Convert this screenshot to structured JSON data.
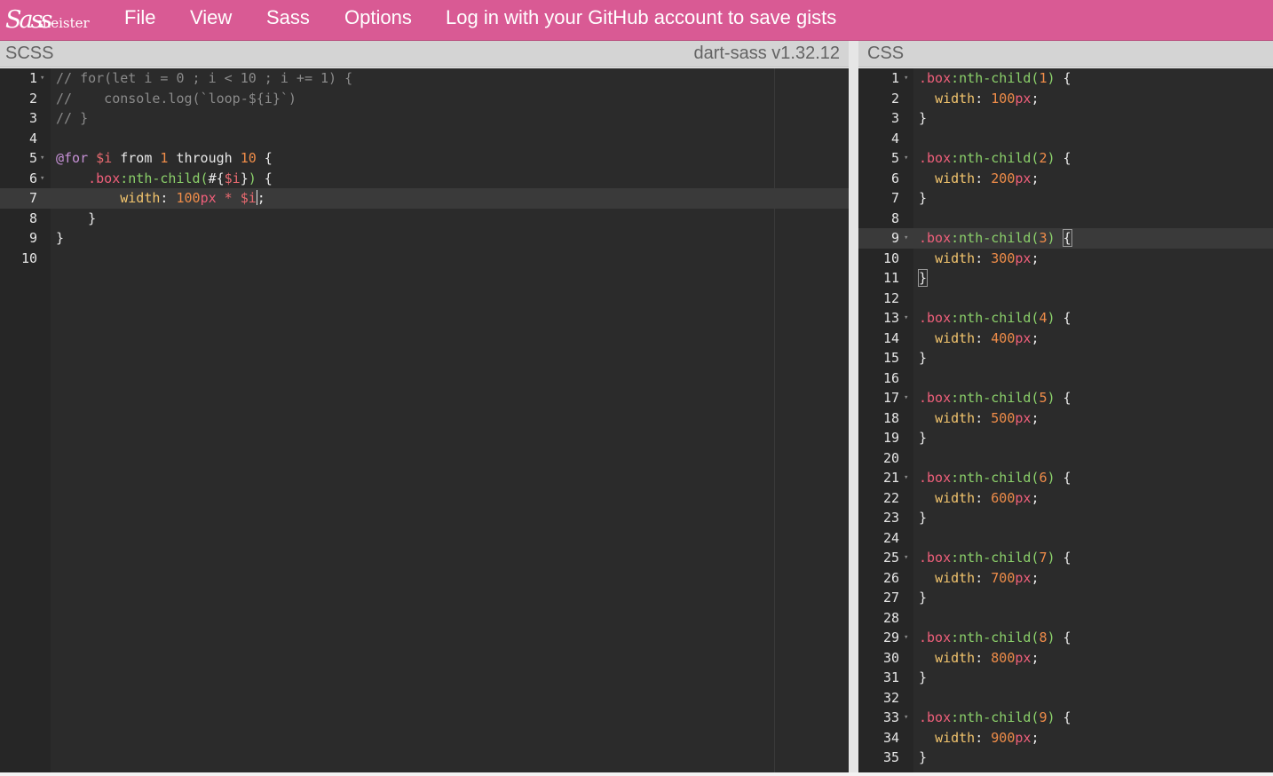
{
  "brand": {
    "logo_script": "Sass",
    "logo_text": "meister"
  },
  "nav": {
    "file": "File",
    "view": "View",
    "sass": "Sass",
    "options": "Options",
    "login": "Log in with your GitHub account to save gists"
  },
  "scss_panel": {
    "title": "SCSS",
    "compiler": "dart-sass v1.32.12"
  },
  "css_panel": {
    "title": "CSS"
  },
  "colors": {
    "topbar": "#d95a94",
    "editor_bg": "#2b2b2b",
    "comment": "#8a8a8a",
    "keyword": "#c691d6",
    "number": "#f08d49",
    "selector": "#ef5f7a",
    "pseudo": "#8bd06a",
    "property": "#f2c46d"
  },
  "scss_lines": [
    {
      "n": "1",
      "fold": true,
      "tokens": [
        [
          "c",
          "// for(let i = 0 ; i < 10 ; i += 1) {"
        ]
      ]
    },
    {
      "n": "2",
      "tokens": [
        [
          "c",
          "//    console.log(`loop-${i}`)"
        ]
      ]
    },
    {
      "n": "3",
      "tokens": [
        [
          "c",
          "// }"
        ]
      ]
    },
    {
      "n": "4",
      "tokens": []
    },
    {
      "n": "5",
      "fold": true,
      "tokens": [
        [
          "k",
          "@for"
        ],
        [
          "p",
          " "
        ],
        [
          "v",
          "$i"
        ],
        [
          "p",
          " from "
        ],
        [
          "n",
          "1"
        ],
        [
          "p",
          " through "
        ],
        [
          "n",
          "10"
        ],
        [
          "p",
          " {"
        ]
      ]
    },
    {
      "n": "6",
      "fold": true,
      "tokens": [
        [
          "p",
          "    "
        ],
        [
          "s",
          ".box"
        ],
        [
          "ps",
          ":nth-child("
        ],
        [
          "p",
          "#{"
        ],
        [
          "v",
          "$i"
        ],
        [
          "p",
          "}"
        ],
        [
          "ps",
          ")"
        ],
        [
          "p",
          " {"
        ]
      ]
    },
    {
      "n": "7",
      "active": true,
      "tokens": [
        [
          "p",
          "        "
        ],
        [
          "pr",
          "width"
        ],
        [
          "p",
          ": "
        ],
        [
          "n",
          "100"
        ],
        [
          "u",
          "px"
        ],
        [
          "p",
          " "
        ],
        [
          "o",
          "*"
        ],
        [
          "p",
          " "
        ],
        [
          "v",
          "$i"
        ],
        [
          "p",
          ";"
        ]
      ]
    },
    {
      "n": "8",
      "tokens": [
        [
          "p",
          "    }"
        ]
      ]
    },
    {
      "n": "9",
      "tokens": [
        [
          "p",
          "}"
        ]
      ]
    },
    {
      "n": "10",
      "tokens": []
    }
  ],
  "css_lines": [
    {
      "n": "1",
      "fold": true,
      "tokens": [
        [
          "s",
          ".box"
        ],
        [
          "ps",
          ":nth-child("
        ],
        [
          "n",
          "1"
        ],
        [
          "ps",
          ")"
        ],
        [
          "p",
          " {"
        ]
      ]
    },
    {
      "n": "2",
      "tokens": [
        [
          "p",
          "  "
        ],
        [
          "pr",
          "width"
        ],
        [
          "p",
          ": "
        ],
        [
          "n",
          "100"
        ],
        [
          "u",
          "px"
        ],
        [
          "p",
          ";"
        ]
      ]
    },
    {
      "n": "3",
      "tokens": [
        [
          "p",
          "}"
        ]
      ]
    },
    {
      "n": "4",
      "tokens": []
    },
    {
      "n": "5",
      "fold": true,
      "tokens": [
        [
          "s",
          ".box"
        ],
        [
          "ps",
          ":nth-child("
        ],
        [
          "n",
          "2"
        ],
        [
          "ps",
          ")"
        ],
        [
          "p",
          " {"
        ]
      ]
    },
    {
      "n": "6",
      "tokens": [
        [
          "p",
          "  "
        ],
        [
          "pr",
          "width"
        ],
        [
          "p",
          ": "
        ],
        [
          "n",
          "200"
        ],
        [
          "u",
          "px"
        ],
        [
          "p",
          ";"
        ]
      ]
    },
    {
      "n": "7",
      "tokens": [
        [
          "p",
          "}"
        ]
      ]
    },
    {
      "n": "8",
      "tokens": []
    },
    {
      "n": "9",
      "fold": true,
      "active": true,
      "tokens": [
        [
          "s",
          ".box"
        ],
        [
          "ps",
          ":nth-child("
        ],
        [
          "n",
          "3"
        ],
        [
          "ps",
          ")"
        ],
        [
          "p",
          " "
        ],
        [
          "bh",
          "{"
        ]
      ]
    },
    {
      "n": "10",
      "tokens": [
        [
          "p",
          "  "
        ],
        [
          "pr",
          "width"
        ],
        [
          "p",
          ": "
        ],
        [
          "n",
          "300"
        ],
        [
          "u",
          "px"
        ],
        [
          "p",
          ";"
        ]
      ]
    },
    {
      "n": "11",
      "tokens": [
        [
          "bh",
          "}"
        ]
      ]
    },
    {
      "n": "12",
      "tokens": []
    },
    {
      "n": "13",
      "fold": true,
      "tokens": [
        [
          "s",
          ".box"
        ],
        [
          "ps",
          ":nth-child("
        ],
        [
          "n",
          "4"
        ],
        [
          "ps",
          ")"
        ],
        [
          "p",
          " {"
        ]
      ]
    },
    {
      "n": "14",
      "tokens": [
        [
          "p",
          "  "
        ],
        [
          "pr",
          "width"
        ],
        [
          "p",
          ": "
        ],
        [
          "n",
          "400"
        ],
        [
          "u",
          "px"
        ],
        [
          "p",
          ";"
        ]
      ]
    },
    {
      "n": "15",
      "tokens": [
        [
          "p",
          "}"
        ]
      ]
    },
    {
      "n": "16",
      "tokens": []
    },
    {
      "n": "17",
      "fold": true,
      "tokens": [
        [
          "s",
          ".box"
        ],
        [
          "ps",
          ":nth-child("
        ],
        [
          "n",
          "5"
        ],
        [
          "ps",
          ")"
        ],
        [
          "p",
          " {"
        ]
      ]
    },
    {
      "n": "18",
      "tokens": [
        [
          "p",
          "  "
        ],
        [
          "pr",
          "width"
        ],
        [
          "p",
          ": "
        ],
        [
          "n",
          "500"
        ],
        [
          "u",
          "px"
        ],
        [
          "p",
          ";"
        ]
      ]
    },
    {
      "n": "19",
      "tokens": [
        [
          "p",
          "}"
        ]
      ]
    },
    {
      "n": "20",
      "tokens": []
    },
    {
      "n": "21",
      "fold": true,
      "tokens": [
        [
          "s",
          ".box"
        ],
        [
          "ps",
          ":nth-child("
        ],
        [
          "n",
          "6"
        ],
        [
          "ps",
          ")"
        ],
        [
          "p",
          " {"
        ]
      ]
    },
    {
      "n": "22",
      "tokens": [
        [
          "p",
          "  "
        ],
        [
          "pr",
          "width"
        ],
        [
          "p",
          ": "
        ],
        [
          "n",
          "600"
        ],
        [
          "u",
          "px"
        ],
        [
          "p",
          ";"
        ]
      ]
    },
    {
      "n": "23",
      "tokens": [
        [
          "p",
          "}"
        ]
      ]
    },
    {
      "n": "24",
      "tokens": []
    },
    {
      "n": "25",
      "fold": true,
      "tokens": [
        [
          "s",
          ".box"
        ],
        [
          "ps",
          ":nth-child("
        ],
        [
          "n",
          "7"
        ],
        [
          "ps",
          ")"
        ],
        [
          "p",
          " {"
        ]
      ]
    },
    {
      "n": "26",
      "tokens": [
        [
          "p",
          "  "
        ],
        [
          "pr",
          "width"
        ],
        [
          "p",
          ": "
        ],
        [
          "n",
          "700"
        ],
        [
          "u",
          "px"
        ],
        [
          "p",
          ";"
        ]
      ]
    },
    {
      "n": "27",
      "tokens": [
        [
          "p",
          "}"
        ]
      ]
    },
    {
      "n": "28",
      "tokens": []
    },
    {
      "n": "29",
      "fold": true,
      "tokens": [
        [
          "s",
          ".box"
        ],
        [
          "ps",
          ":nth-child("
        ],
        [
          "n",
          "8"
        ],
        [
          "ps",
          ")"
        ],
        [
          "p",
          " {"
        ]
      ]
    },
    {
      "n": "30",
      "tokens": [
        [
          "p",
          "  "
        ],
        [
          "pr",
          "width"
        ],
        [
          "p",
          ": "
        ],
        [
          "n",
          "800"
        ],
        [
          "u",
          "px"
        ],
        [
          "p",
          ";"
        ]
      ]
    },
    {
      "n": "31",
      "tokens": [
        [
          "p",
          "}"
        ]
      ]
    },
    {
      "n": "32",
      "tokens": []
    },
    {
      "n": "33",
      "fold": true,
      "tokens": [
        [
          "s",
          ".box"
        ],
        [
          "ps",
          ":nth-child("
        ],
        [
          "n",
          "9"
        ],
        [
          "ps",
          ")"
        ],
        [
          "p",
          " {"
        ]
      ]
    },
    {
      "n": "34",
      "tokens": [
        [
          "p",
          "  "
        ],
        [
          "pr",
          "width"
        ],
        [
          "p",
          ": "
        ],
        [
          "n",
          "900"
        ],
        [
          "u",
          "px"
        ],
        [
          "p",
          ";"
        ]
      ]
    },
    {
      "n": "35",
      "tokens": [
        [
          "p",
          "}"
        ]
      ]
    }
  ]
}
